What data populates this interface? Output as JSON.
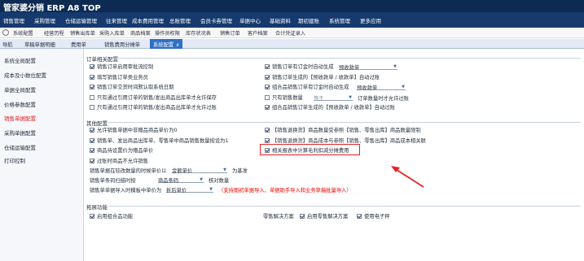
{
  "app": {
    "title": "管家婆分销 ERP A8 TOP"
  },
  "menu": [
    "销售管理",
    "采购管理",
    "仓储运输管理",
    "往来管理",
    "成本费用管理",
    "总账管理",
    "会员卡券管理",
    "单据中心",
    "基础资料",
    "期初建账",
    "系统管理",
    "更多应用"
  ],
  "toolbar": [
    "系统配置",
    "经营历程",
    "销售出库单",
    "采购入库单",
    "商品档案",
    "操作员权限",
    "库存状况表",
    "销售订单",
    "客户档案",
    "合计凭证录入"
  ],
  "tabs": {
    "nav": "导航",
    "t1": "草稿单据明细",
    "t2": "费用单",
    "t3": "销售费用分摊单",
    "active": "系统配置",
    "close": "x"
  },
  "sidebar": [
    "系统全局配置",
    "成本及小数位配置",
    "单据全局配置",
    "价格参数配置",
    "销售单据配置",
    "采购单据配置",
    "仓储运输配置",
    "打印控制"
  ],
  "sidebar_active_index": 4,
  "order": {
    "title": "订单相关配置",
    "left": [
      {
        "label": "销售订单启用审批流控制",
        "checked": true
      },
      {
        "label": "填写销售订单类业务员",
        "checked": true
      },
      {
        "label": "销售订单交货时间默认取系统日期",
        "checked": true
      },
      {
        "label": "只有通过引用订单的销售/发出商品出库单才允许保存",
        "checked": false
      },
      {
        "label": "只有通过引用订单的销售/发出商品出库单才允许过账",
        "checked": false
      }
    ],
    "right": {
      "r1": {
        "label": "销售订单有订金时自动生成",
        "checked": true,
        "select": "预收款单"
      },
      "r2": {
        "label": "销售订单生成的【预收款单 / 收款单】自动过账",
        "checked": true
      },
      "r3": {
        "label": "组合品销售订单有订金时自动生成",
        "checked": true,
        "select": "预收款单"
      },
      "r4": {
        "label": "只有销售数量",
        "checked": false,
        "op": "等于",
        "suffix": "订单数量时才允许过账"
      },
      "r5": {
        "label": "组合品销售订单生成的【预收款单 / 收款单】自动过账",
        "checked": true
      }
    }
  },
  "other": {
    "title": "其他配置",
    "left": [
      {
        "label": "允许销售单据中非赠品商品单价为0",
        "checked": true
      },
      {
        "label": "销售单、发出商品出库单、零售单中商品销售数量按设为1",
        "checked": true
      },
      {
        "label": "商品待设置价为赠品单价",
        "checked": true
      },
      {
        "label": "过账时商品不允许销售",
        "checked": true
      }
    ],
    "right": [
      {
        "label": "【销售退换货】商品数量受参照【销售、零售出库】商品数量限制",
        "checked": true
      },
      {
        "label": "【销售退换货】商品成本与参照【销售、零售出库】商品成本相关联",
        "checked": true
      },
      {
        "label": "相关报表中计算毛利扣减分摊费用",
        "checked": true
      }
    ],
    "rows": {
      "row1": {
        "label": "销售单据在较改数量的时候单价以",
        "select": "金额单价",
        "suffix": "为基准"
      },
      "row2": {
        "label": "销售单条码扫描时按",
        "select": "商品条码",
        "suffix": "核对数量"
      },
      "row3": {
        "label": "销售单单据导入时模板中单价为",
        "select": "折后单价",
        "note": "（支持期初单据导入、单据助手导入和业务草稿批量导入）"
      }
    }
  },
  "ext": {
    "title": "拓展功能",
    "left": {
      "label": "启用组合品功能",
      "checked": true
    },
    "zero_label": "零售解决方案",
    "opt1": {
      "label": "启用零售解决方案",
      "checked": true
    },
    "opt2": {
      "label": "使用电子秤",
      "checked": true
    }
  },
  "colors": {
    "accent": "#e52222",
    "nav": "#163a6e",
    "titlebar": "#0d2a52"
  }
}
